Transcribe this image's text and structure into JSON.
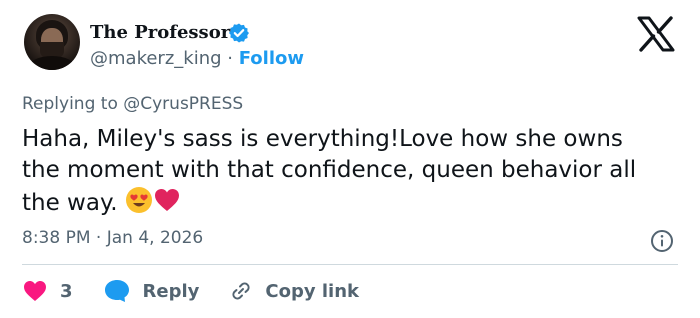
{
  "author": {
    "display_name": "The Professor",
    "handle": "@makerz_king",
    "separator": "·",
    "follow_label": "Follow",
    "verified": true
  },
  "reply_context": {
    "prefix": "Replying to",
    "mention": "@CyrusPRESS"
  },
  "tweet": {
    "text": "Haha, Miley's sass is everything!Love how she owns the moment with that confidence, queen behavior all the way.",
    "emojis": [
      "heart-eyes-emoji",
      "red-heart-emoji"
    ],
    "time": "8:38 PM",
    "separator": "·",
    "date": "Jan 4, 2026"
  },
  "actions": {
    "like_count": "3",
    "reply_label": "Reply",
    "copy_label": "Copy link"
  },
  "icons": {
    "platform": "x-logo-icon",
    "verified": "verified-badge-icon",
    "info": "info-icon",
    "like": "heart-icon",
    "reply": "speech-bubble-icon",
    "copy": "link-icon"
  },
  "colors": {
    "accent": "#1d9bf0",
    "like": "#f91880",
    "text": "#0f1419",
    "muted": "#536471"
  }
}
